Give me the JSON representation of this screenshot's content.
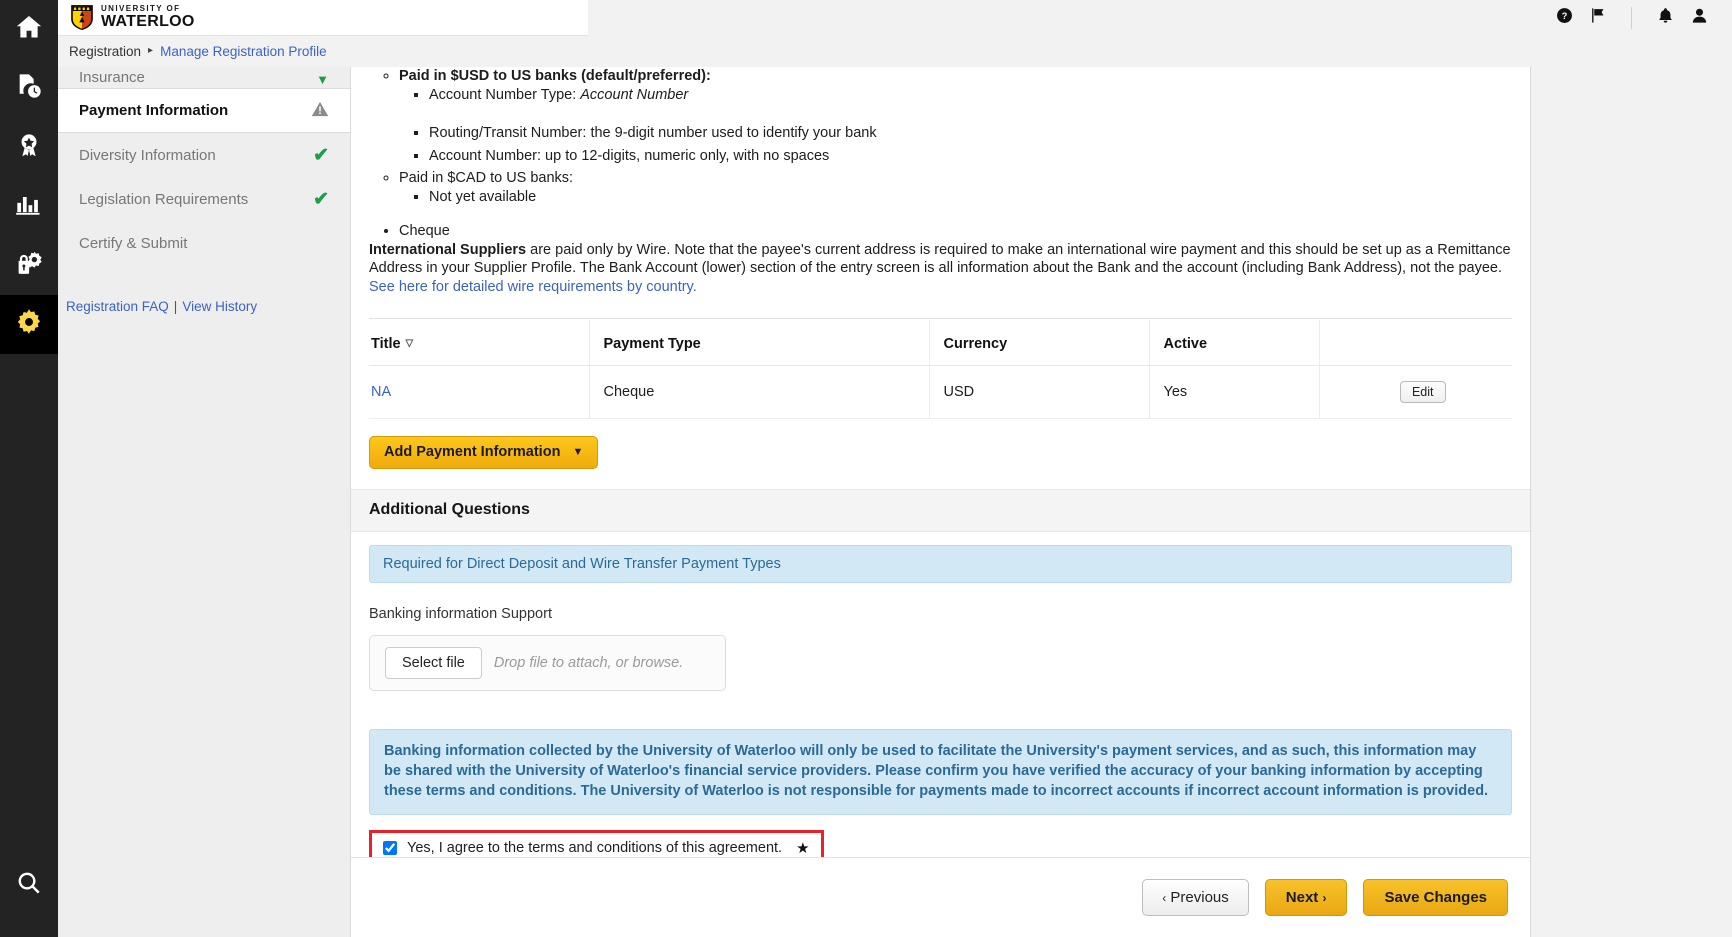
{
  "rail": {
    "items": [
      {
        "icon": "home-icon",
        "name": "home"
      },
      {
        "icon": "document-clock-icon",
        "name": "pending-documents"
      },
      {
        "icon": "award-ribbon-icon",
        "name": "awards"
      },
      {
        "icon": "bar-chart-icon",
        "name": "reports"
      },
      {
        "icon": "lock-gear-icon",
        "name": "admin-security"
      },
      {
        "icon": "gear-icon",
        "name": "settings",
        "active": true
      }
    ],
    "bottom": {
      "icon": "search-icon",
      "name": "search"
    }
  },
  "topbar": {
    "logo": {
      "line1": "UNIVERSITY OF",
      "line2": "WATERLOO"
    },
    "icons": [
      {
        "icon": "help-icon",
        "name": "help"
      },
      {
        "icon": "flag-icon",
        "name": "flag"
      },
      {
        "icon": "bell-icon",
        "name": "notifications"
      },
      {
        "icon": "user-icon",
        "name": "profile"
      }
    ]
  },
  "breadcrumb": {
    "root": "Registration",
    "arrow": "▸",
    "current": "Manage Registration Profile"
  },
  "nav": {
    "items": [
      {
        "label": "Insurance",
        "status": "caret-down",
        "state": "partial"
      },
      {
        "label": "Payment Information",
        "status": "warning",
        "state": "current"
      },
      {
        "label": "Diversity Information",
        "status": "check",
        "state": "done"
      },
      {
        "label": "Legislation Requirements",
        "status": "check",
        "state": "done"
      },
      {
        "label": "Certify & Submit",
        "status": "none",
        "state": "todo"
      }
    ],
    "links": {
      "faq": "Registration FAQ",
      "separator": "|",
      "history": "View History"
    }
  },
  "main": {
    "wire_details": {
      "usd_heading": "Paid in $USD to US banks (default/preferred):",
      "usd_items": [
        {
          "prefix": "Account Number Type: ",
          "emphasis": "Account Number"
        },
        {
          "prefix": "Routing/Transit Number: the 9-digit number used to identify your bank",
          "emphasis": ""
        },
        {
          "prefix": "Account Number: up to 12-digits, numeric only, with no spaces",
          "emphasis": ""
        }
      ],
      "cad_heading": "Paid in $CAD to US banks:",
      "cad_items": [
        "Not yet available"
      ],
      "cheque": "Cheque"
    },
    "intl_paragraph": {
      "bold_lead": "International Suppliers",
      "rest": " are paid only by Wire.  Note that the payee's current address is required to make an international wire payment and this should be set up as a Remittance Address in your Supplier Profile.  The Bank Account (lower) section of the entry screen is all information about the Bank and the account (including Bank Address), not the payee."
    },
    "wire_link": "See here for detailed wire requirements by country.",
    "table": {
      "headers": [
        "Title",
        "Payment Type",
        "Currency",
        "Active",
        ""
      ],
      "sort_indicator": "▽",
      "rows": [
        {
          "title": "NA",
          "payment_type": "Cheque",
          "currency": "USD",
          "active": "Yes",
          "action": "Edit"
        }
      ]
    },
    "add_payment_button": {
      "label": "Add Payment Information",
      "caret": "▼"
    },
    "additional_questions": {
      "heading": "Additional Questions",
      "info_band": "Required for Direct Deposit and Wire Transfer Payment Types",
      "field_label": "Banking information Support",
      "select_file_button": "Select file",
      "drop_hint": "Drop file to attach, or browse."
    },
    "terms": {
      "band_text": "Banking information collected by the University of Waterloo will only be used to facilitate the University's payment services, and as such, this information may be shared with the University of Waterloo's financial service providers. Please confirm you have verified the accuracy of your banking information by accepting these terms and conditions. The University of Waterloo is not responsible for payments made to incorrect accounts if incorrect account information is provided.",
      "agree_label": "Yes, I agree to the terms and conditions of this agreement.",
      "required_marker": "★",
      "checked": true
    }
  },
  "footer": {
    "previous": "Previous",
    "previous_chevron": "‹",
    "next": "Next",
    "next_chevron": "›",
    "save": "Save Changes"
  },
  "colors": {
    "rail_bg": "#232323",
    "accent_gold": "#f0ab0c",
    "link_blue": "#3b63c4",
    "success_green": "#1f9e4a",
    "info_blue_bg": "#d2e9f5",
    "info_blue_text": "#2b6a96",
    "highlight_red": "#e8222b"
  }
}
